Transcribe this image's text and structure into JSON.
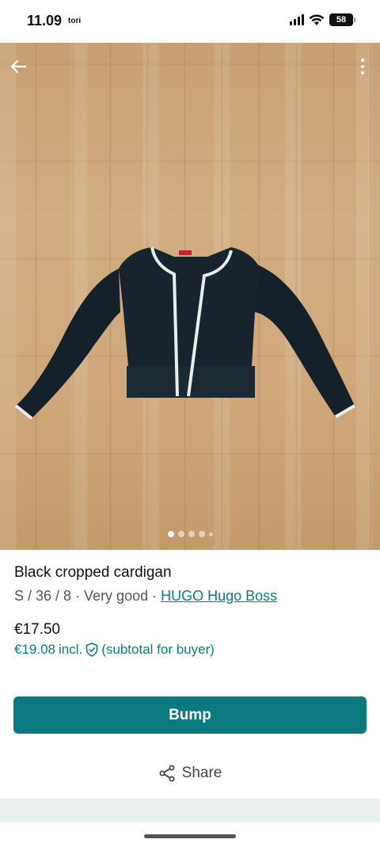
{
  "status_bar": {
    "time": "11.09",
    "carrier": "tori",
    "battery": "58"
  },
  "gallery": {
    "image_count": 5,
    "active_index": 0,
    "icons": {
      "back": "arrow-left-icon",
      "more": "vertical-dots-icon"
    }
  },
  "item": {
    "title": "Black cropped cardigan",
    "meta_prefix": "S / 36 / 8 · Very good · ",
    "brand": "HUGO Hugo Boss",
    "price": "€17.50",
    "price_incl_amount": "€19.08",
    "price_incl_label": "incl.",
    "price_incl_note": "(subtotal for buyer)"
  },
  "actions": {
    "bump_label": "Bump",
    "share_label": "Share"
  },
  "colors": {
    "accent": "#0b7a80",
    "bottom_band": "#eaf0ef"
  }
}
